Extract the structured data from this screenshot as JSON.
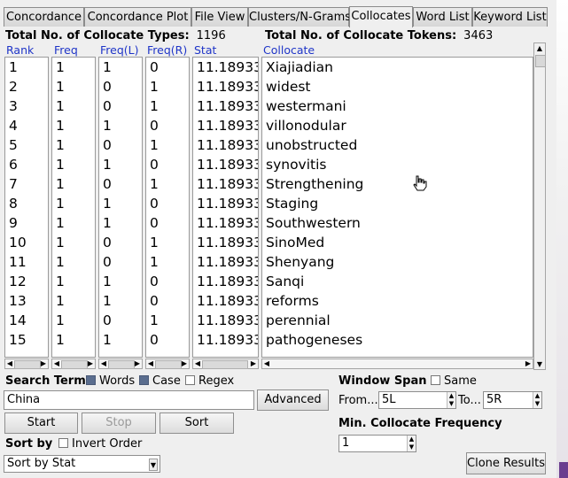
{
  "tabs": [
    "Concordance",
    "Concordance Plot",
    "File View",
    "Clusters/N-Grams",
    "Collocates",
    "Word List",
    "Keyword List"
  ],
  "active_tab": "Collocates",
  "summary": {
    "types_label": "Total No. of Collocate Types:",
    "types_value": "1196",
    "tokens_label": "Total No. of Collocate Tokens:",
    "tokens_value": "3463"
  },
  "columns": {
    "rank": "Rank",
    "freq": "Freq",
    "freq_l": "Freq(L)",
    "freq_r": "Freq(R)",
    "stat": "Stat",
    "collocate": "Collocate"
  },
  "rows": [
    {
      "rank": "1",
      "freq": "1",
      "freq_l": "1",
      "freq_r": "0",
      "stat": "11.18933",
      "collocate": "Xiajiadian"
    },
    {
      "rank": "2",
      "freq": "1",
      "freq_l": "0",
      "freq_r": "1",
      "stat": "11.18933",
      "collocate": "widest"
    },
    {
      "rank": "3",
      "freq": "1",
      "freq_l": "0",
      "freq_r": "1",
      "stat": "11.18933",
      "collocate": "westermani"
    },
    {
      "rank": "4",
      "freq": "1",
      "freq_l": "1",
      "freq_r": "0",
      "stat": "11.18933",
      "collocate": "villonodular"
    },
    {
      "rank": "5",
      "freq": "1",
      "freq_l": "0",
      "freq_r": "1",
      "stat": "11.18933",
      "collocate": "unobstructed"
    },
    {
      "rank": "6",
      "freq": "1",
      "freq_l": "1",
      "freq_r": "0",
      "stat": "11.18933",
      "collocate": "synovitis"
    },
    {
      "rank": "7",
      "freq": "1",
      "freq_l": "0",
      "freq_r": "1",
      "stat": "11.18933",
      "collocate": "Strengthening"
    },
    {
      "rank": "8",
      "freq": "1",
      "freq_l": "1",
      "freq_r": "0",
      "stat": "11.18933",
      "collocate": "Staging"
    },
    {
      "rank": "9",
      "freq": "1",
      "freq_l": "1",
      "freq_r": "0",
      "stat": "11.18933",
      "collocate": "Southwestern"
    },
    {
      "rank": "10",
      "freq": "1",
      "freq_l": "0",
      "freq_r": "1",
      "stat": "11.18933",
      "collocate": "SinoMed"
    },
    {
      "rank": "11",
      "freq": "1",
      "freq_l": "0",
      "freq_r": "1",
      "stat": "11.18933",
      "collocate": "Shenyang"
    },
    {
      "rank": "12",
      "freq": "1",
      "freq_l": "1",
      "freq_r": "0",
      "stat": "11.18933",
      "collocate": "Sanqi"
    },
    {
      "rank": "13",
      "freq": "1",
      "freq_l": "1",
      "freq_r": "0",
      "stat": "11.18933",
      "collocate": "reforms"
    },
    {
      "rank": "14",
      "freq": "1",
      "freq_l": "0",
      "freq_r": "1",
      "stat": "11.18933",
      "collocate": "perennial"
    },
    {
      "rank": "15",
      "freq": "1",
      "freq_l": "1",
      "freq_r": "0",
      "stat": "11.18933",
      "collocate": "pathogeneses"
    }
  ],
  "search": {
    "label": "Search Term",
    "words_label": "Words",
    "words_checked": true,
    "case_label": "Case",
    "case_checked": true,
    "regex_label": "Regex",
    "regex_checked": false,
    "value": "China",
    "advanced_label": "Advanced"
  },
  "buttons": {
    "start": "Start",
    "stop": "Stop",
    "sort": "Sort",
    "clone": "Clone Results"
  },
  "sort_by": {
    "label": "Sort by",
    "invert_label": "Invert Order",
    "invert_checked": false,
    "selected": "Sort by Stat"
  },
  "window_span": {
    "label": "Window Span",
    "same_label": "Same",
    "same_checked": false,
    "from_label": "From...",
    "from_value": "5L",
    "to_label": "To...",
    "to_value": "5R"
  },
  "min_freq": {
    "label": "Min. Collocate Frequency",
    "value": "1"
  }
}
